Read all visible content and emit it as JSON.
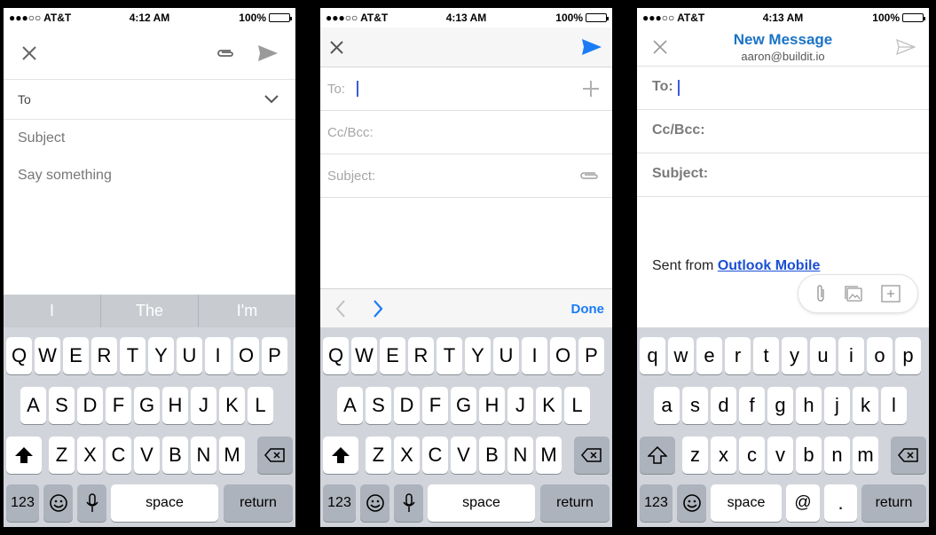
{
  "phones": [
    {
      "status": {
        "carrier": "●●●○○ AT&T",
        "time": "4:12 AM",
        "battery": "100%"
      },
      "to_label": "To",
      "subject_placeholder": "Subject",
      "body_placeholder": "Say something",
      "suggestions": [
        "I",
        "The",
        "I'm"
      ],
      "keyboard": {
        "row1": [
          "Q",
          "W",
          "E",
          "R",
          "T",
          "Y",
          "U",
          "I",
          "O",
          "P"
        ],
        "row2": [
          "A",
          "S",
          "D",
          "F",
          "G",
          "H",
          "J",
          "K",
          "L"
        ],
        "row3": [
          "Z",
          "X",
          "C",
          "V",
          "B",
          "N",
          "M"
        ],
        "numbers": "123",
        "space": "space",
        "return": "return"
      }
    },
    {
      "status": {
        "carrier": "●●●○○ AT&T",
        "time": "4:13 AM",
        "battery": "100%"
      },
      "to_label": "To:",
      "cc_label": "Cc/Bcc:",
      "subject_label": "Subject:",
      "done_label": "Done",
      "keyboard": {
        "row1": [
          "Q",
          "W",
          "E",
          "R",
          "T",
          "Y",
          "U",
          "I",
          "O",
          "P"
        ],
        "row2": [
          "A",
          "S",
          "D",
          "F",
          "G",
          "H",
          "J",
          "K",
          "L"
        ],
        "row3": [
          "Z",
          "X",
          "C",
          "V",
          "B",
          "N",
          "M"
        ],
        "numbers": "123",
        "space": "space",
        "return": "return"
      }
    },
    {
      "status": {
        "carrier": "●●●○○ AT&T",
        "time": "4:13 AM",
        "battery": "100%"
      },
      "title": "New Message",
      "account": "aaron@buildit.io",
      "to_label": "To:",
      "cc_label": "Cc/Bcc:",
      "subject_label": "Subject:",
      "signature_prefix": "Sent from ",
      "signature_link": "Outlook Mobile",
      "keyboard": {
        "row1": [
          "q",
          "w",
          "e",
          "r",
          "t",
          "y",
          "u",
          "i",
          "o",
          "p"
        ],
        "row2": [
          "a",
          "s",
          "d",
          "f",
          "g",
          "h",
          "j",
          "k",
          "l"
        ],
        "row3": [
          "z",
          "x",
          "c",
          "v",
          "b",
          "n",
          "m"
        ],
        "numbers": "123",
        "space": "space",
        "at": "@",
        "dot": ".",
        "return": "return"
      }
    }
  ],
  "colors": {
    "ios_blue": "#1a7cf5",
    "outlook_blue": "#1a73c4",
    "link_blue": "#1a4fd4",
    "keyboard_bg": "#d1d5db"
  }
}
